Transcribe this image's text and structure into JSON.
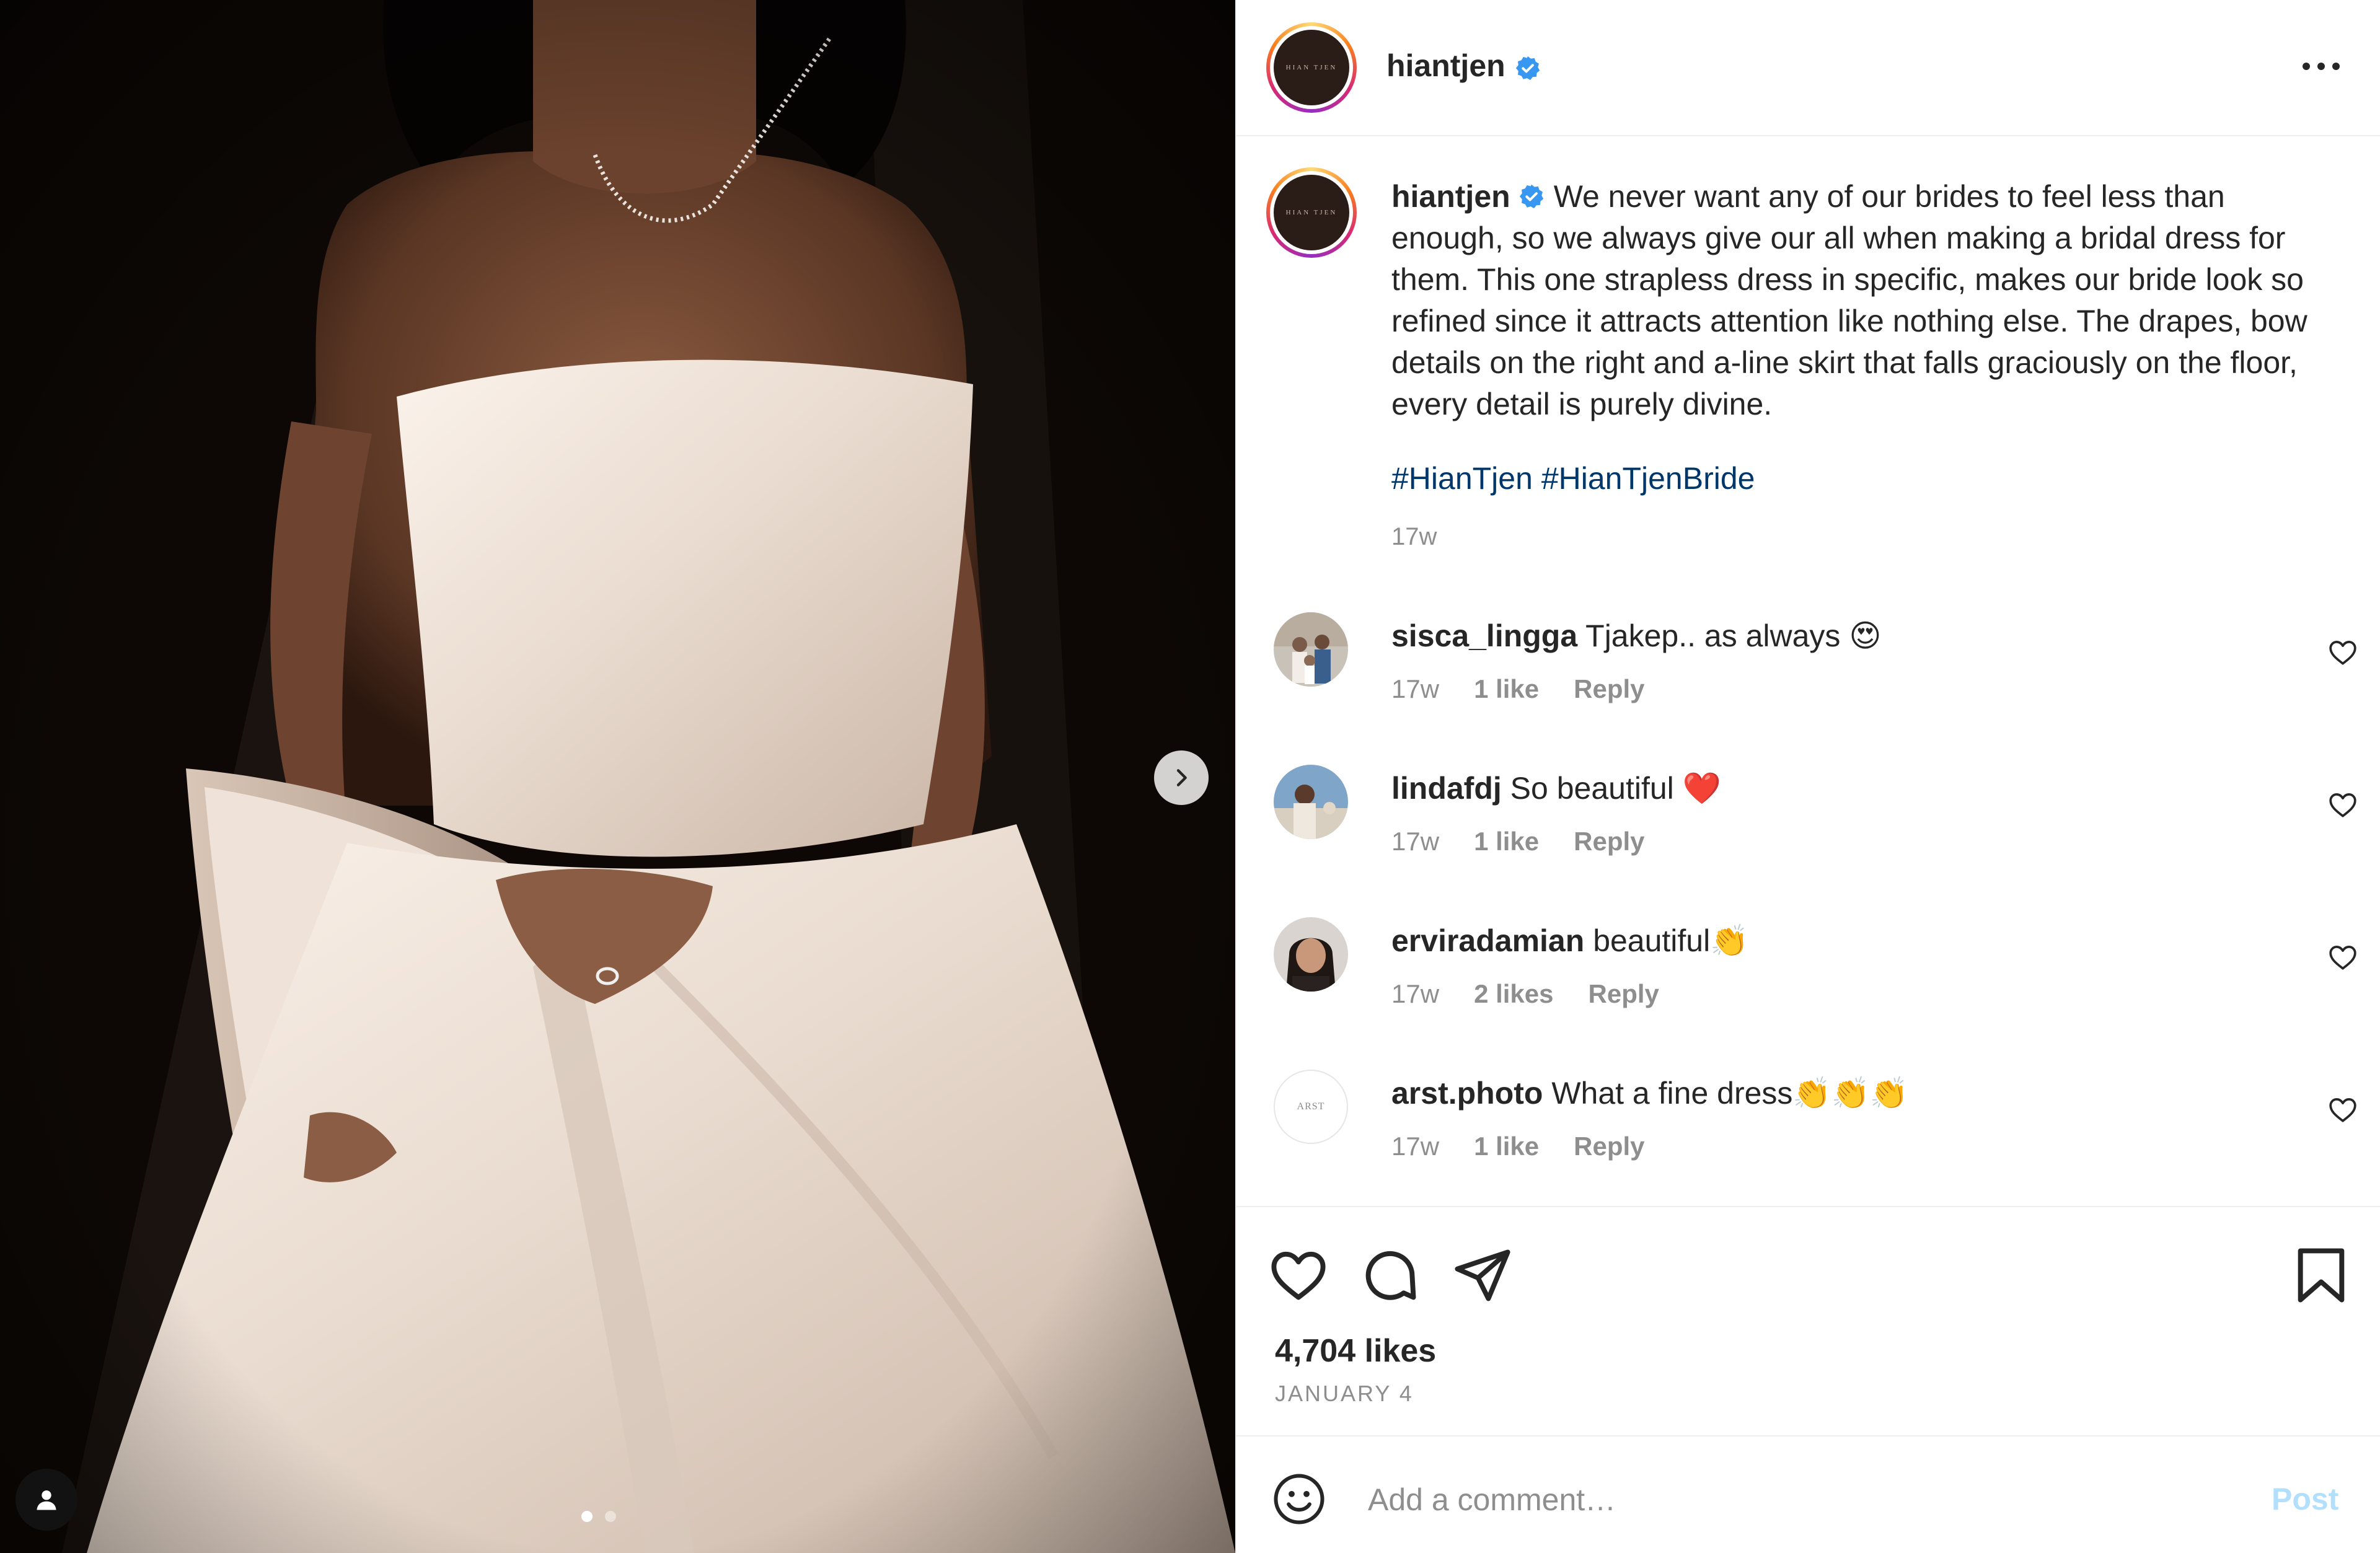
{
  "post": {
    "author": "hiantjen",
    "author_verified": true,
    "logo_text": "HIAN TJEN",
    "caption": "We never want any of our brides to feel less than enough, so we always give our all when making a bridal dress for them. This one strapless dress in specific, makes our bride look so refined since it attracts attention like nothing else. The drapes, bow details on the right and a-line skirt that falls graciously on the floor, every detail is purely divine.",
    "hashtags": [
      "#HianTjen",
      "#HianTjenBride"
    ],
    "caption_time": "17w",
    "likes": "4,704 likes",
    "date": "JANUARY 4",
    "carousel": {
      "current": 1,
      "total": 2
    }
  },
  "comments": [
    {
      "user": "sisca_lingga",
      "text": "Tjakep.. as always 😍",
      "time": "17w",
      "likes": "1 like",
      "reply": "Reply"
    },
    {
      "user": "lindafdj",
      "text": "So beautiful ❤️",
      "time": "17w",
      "likes": "1 like",
      "reply": "Reply"
    },
    {
      "user": "erviradamian",
      "text": "beautiful👏",
      "time": "17w",
      "likes": "2 likes",
      "reply": "Reply"
    },
    {
      "user": "arst.photo",
      "text": "What a fine dress👏👏👏",
      "time": "17w",
      "likes": "1 like",
      "reply": "Reply",
      "avatar_text": "ARST"
    }
  ],
  "composer": {
    "placeholder": "Add a comment…",
    "post_label": "Post"
  },
  "icons": {
    "more": "more-horizontal-icon",
    "next": "chevron-right-icon",
    "tag": "user-tag-icon",
    "like": "heart-icon",
    "comment": "comment-bubble-icon",
    "share": "paper-plane-icon",
    "save": "bookmark-icon",
    "emoji": "smiley-icon",
    "verified": "verified-badge-icon"
  },
  "colors": {
    "verified": "#3897f0",
    "hashtag": "#00376b",
    "post_disabled": "#b2dffc",
    "muted": "#8e8e8e"
  }
}
